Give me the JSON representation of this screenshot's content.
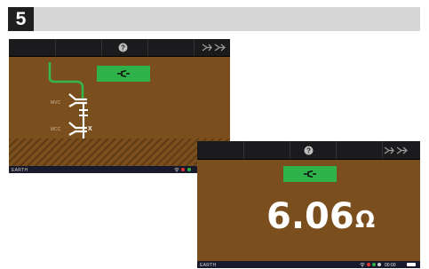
{
  "step": {
    "number": "5"
  },
  "screen1": {
    "labels": {
      "upper": "MVC",
      "lower": "MCC",
      "x_marker": "X"
    },
    "status": {
      "label": "EARTH"
    }
  },
  "screen2": {
    "reading": {
      "value": "6.06",
      "unit": "Ω"
    },
    "status": {
      "label": "EARTH",
      "time": "00:00"
    }
  },
  "colors": {
    "background_brown": "#7a4f1d",
    "toolbar_dark": "#1b1b1e",
    "statusbar_navy": "#181a2c",
    "accent_green": "#2fb24a",
    "text_white": "#ffffff"
  },
  "icons": [
    "help-icon",
    "continuity-icon",
    "transistor-icon",
    "wifi-icon",
    "battery-icon"
  ]
}
